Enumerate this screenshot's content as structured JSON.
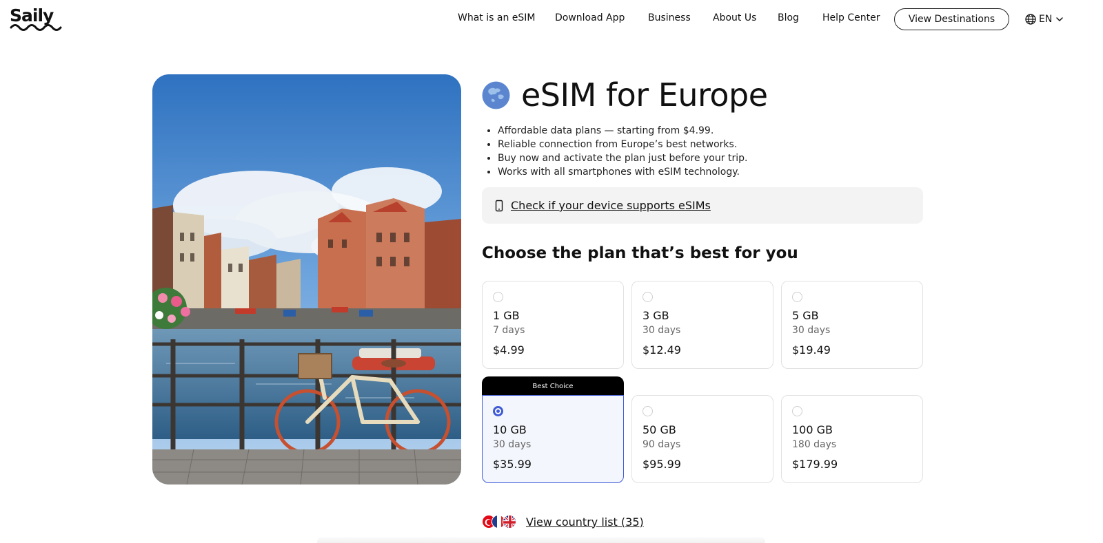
{
  "header": {
    "logo": "Saily",
    "nav": [
      {
        "label": "What is an eSIM"
      },
      {
        "label": "Download App"
      },
      {
        "label": "Business"
      },
      {
        "label": "About Us"
      },
      {
        "label": "Blog"
      },
      {
        "label": "Help Center"
      }
    ],
    "cta_label": "View Destinations",
    "language": "EN"
  },
  "product": {
    "title": "eSIM for Europe",
    "bullets": [
      "Affordable data plans — starting from $4.99.",
      "Reliable connection from Europe’s best networks.",
      "Buy now and activate the plan just before your trip.",
      "Works with all smartphones with eSIM technology."
    ],
    "device_check_label": "Check if your device supports eSIMs"
  },
  "plans": {
    "heading": "Choose the plan that’s best for you",
    "best_choice_label": "Best Choice",
    "items": [
      {
        "data": "1 GB",
        "duration": "7 days",
        "price": "$4.99",
        "selected": false
      },
      {
        "data": "3 GB",
        "duration": "30 days",
        "price": "$12.49",
        "selected": false
      },
      {
        "data": "5 GB",
        "duration": "30 days",
        "price": "$19.49",
        "selected": false
      },
      {
        "data": "10 GB",
        "duration": "30 days",
        "price": "$35.99",
        "selected": true
      },
      {
        "data": "50 GB",
        "duration": "90 days",
        "price": "$95.99",
        "selected": false
      },
      {
        "data": "100 GB",
        "duration": "180 days",
        "price": "$179.99",
        "selected": false
      }
    ]
  },
  "countries": {
    "link_label": "View country list (35)"
  },
  "colors": {
    "accent": "#3f5bd6",
    "selected_bg": "#f3f6fc",
    "badge_bg": "#000000",
    "check_bg": "#f3f3f3"
  }
}
